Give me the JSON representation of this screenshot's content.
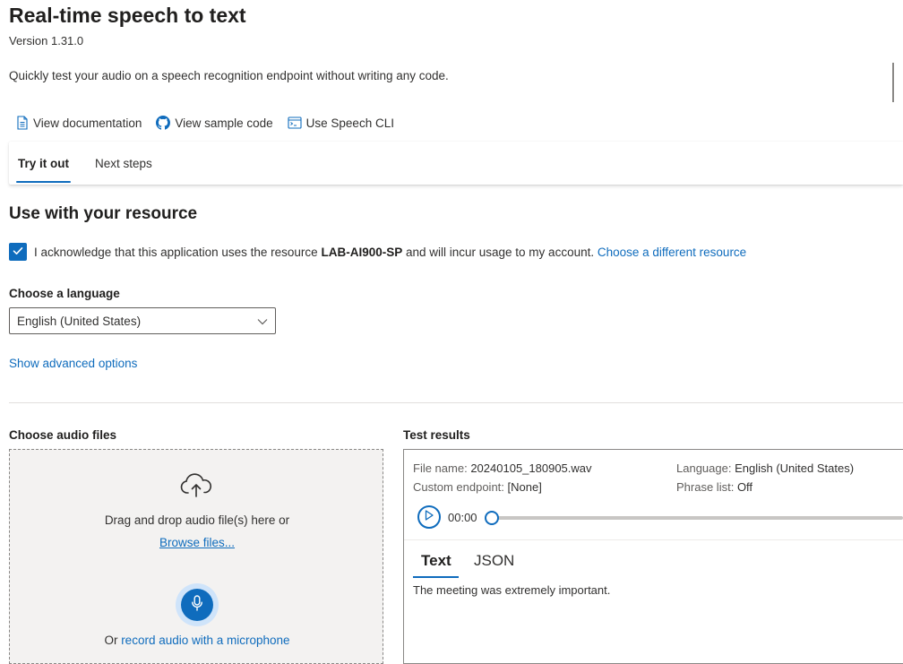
{
  "header": {
    "title": "Real-time speech to text",
    "version": "Version 1.31.0",
    "description": "Quickly test your audio on a speech recognition endpoint without writing any code."
  },
  "links": {
    "documentation": "View documentation",
    "sample_code": "View sample code",
    "speech_cli": "Use Speech CLI"
  },
  "tabs": {
    "try_it_out": "Try it out",
    "next_steps": "Next steps",
    "active": "Try it out"
  },
  "resource": {
    "heading": "Use with your resource",
    "ack_prefix": "I acknowledge that this application uses the resource ",
    "resource_name": "LAB-AI900-SP",
    "ack_suffix": " and will incur usage to my account. ",
    "change_link": "Choose a different resource",
    "acknowledged": true
  },
  "language": {
    "label": "Choose a language",
    "selected": "English (United States)",
    "advanced_link": "Show advanced options"
  },
  "audio": {
    "label": "Choose audio files",
    "drag_text": "Drag and drop audio file(s) here or",
    "browse": "Browse files...",
    "or_prefix": "Or ",
    "record_link": "record audio with a microphone"
  },
  "results": {
    "label": "Test results",
    "file_name_label": "File name:",
    "file_name": "20240105_180905.wav",
    "custom_endpoint_label": "Custom endpoint:",
    "custom_endpoint": "[None]",
    "language_label": "Language:",
    "language": "English (United States)",
    "phrase_list_label": "Phrase list:",
    "phrase_list": "Off",
    "time": "00:00",
    "tab_text": "Text",
    "tab_json": "JSON",
    "active_tab": "Text",
    "transcript": "The meeting was extremely important."
  },
  "colors": {
    "accent": "#0f6cbd",
    "text": "#323130",
    "dropzone_bg": "#f3f2f1"
  },
  "icons": {
    "documentation": "document-icon",
    "sample_code": "github-icon",
    "speech_cli": "terminal-icon",
    "upload": "cloud-upload-icon",
    "record": "microphone-icon",
    "play": "play-icon",
    "dropdown": "chevron-down-icon",
    "checkbox": "checkmark-icon"
  }
}
